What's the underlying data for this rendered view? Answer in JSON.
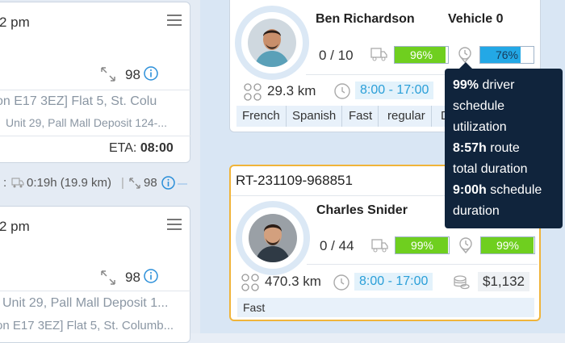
{
  "left_panel": {
    "card1": {
      "time": "2 pm",
      "count": "98",
      "address1": "on E17 3EZ] Flat 5, St. Colu",
      "address2": "Unit 29, Pall Mall Deposit 124-...",
      "eta_label": "ETA:",
      "eta_value": "08:00"
    },
    "between": {
      "duration": "0:19h (19.9 km)",
      "count": "98"
    },
    "card2": {
      "time": "2 pm",
      "count": "98",
      "address1": "Unit 29, Pall Mall Deposit 1...",
      "address2": "on E17 3EZ] Flat 5, St. Columb..."
    }
  },
  "driver1": {
    "name": "Ben Richardson",
    "vehicle": "Vehicle 0",
    "stops": "0 / 10",
    "capacity_pct": "96%",
    "capacity_value": 0.96,
    "schedule_pct": "76%",
    "schedule_value": 0.76,
    "distance": "29.3 km",
    "hours": "8:00 - 17:00",
    "tags": [
      "French",
      "Spanish",
      "Fast",
      "regular",
      "D"
    ]
  },
  "driver2": {
    "route_id": "RT-231109-968851",
    "name": "Charles Snider",
    "stops": "0 / 44",
    "capacity_pct": "99%",
    "capacity_value": 0.99,
    "schedule_pct": "99%",
    "schedule_value": 0.99,
    "distance": "470.3 km",
    "hours": "8:00 - 17:00",
    "cost": "$1,132",
    "tags": [
      "Fast"
    ]
  },
  "tooltip": {
    "line1_bold": "99%",
    "line1_rest": " driver",
    "line2": "schedule",
    "line3": "utilization",
    "line4_bold": "8:57h",
    "line4_rest": " route",
    "line5": "total duration",
    "line6_bold": "9:00h",
    "line6_rest": " schedule",
    "line7": "duration"
  },
  "colors": {
    "green": "#6fcf1f",
    "blue": "#23a8e6",
    "accent_orange": "#f0b43a"
  },
  "icons": [
    "menu-icon",
    "expand-icon",
    "info-icon",
    "route-distance-icon",
    "clock-icon",
    "truck-icon",
    "location-pin-icon",
    "coins-icon"
  ]
}
